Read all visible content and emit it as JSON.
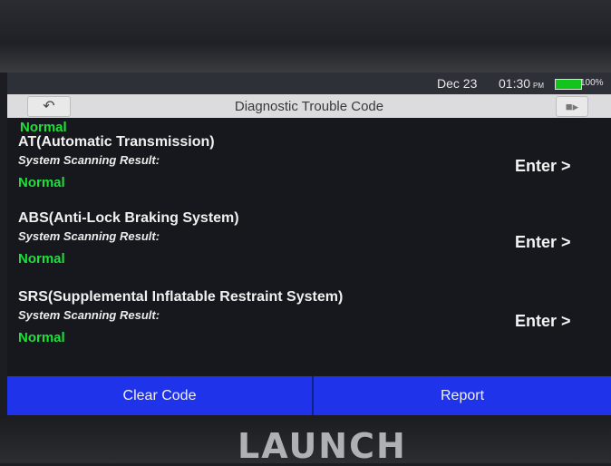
{
  "device": {
    "brand": "LAUNCH"
  },
  "statusbar": {
    "date": "Dec 23",
    "time": "01:30",
    "ampm": "PM",
    "battery_pct": "100%",
    "battery_level": 1.0
  },
  "titlebar": {
    "title": "Diagnostic Trouble Code",
    "back_icon": "back-arrow-icon",
    "exit_icon": "exit-icon"
  },
  "list": {
    "previous_status": "Normal",
    "items": [
      {
        "name": "AT(Automatic Transmission)",
        "label": "System Scanning Result:",
        "status": "Normal",
        "action": "Enter >"
      },
      {
        "name": "ABS(Anti-Lock Braking System)",
        "label": "System Scanning Result:",
        "status": "Normal",
        "action": "Enter >"
      },
      {
        "name": "SRS(Supplemental Inflatable Restraint System)",
        "label": "System Scanning Result:",
        "status": "Normal",
        "action": "Enter >"
      }
    ]
  },
  "footer": {
    "clear_label": "Clear Code",
    "report_label": "Report"
  },
  "colors": {
    "status_green": "#1ee03a",
    "footer_blue": "#1f33ea",
    "titlebar": "#dcdcde"
  }
}
